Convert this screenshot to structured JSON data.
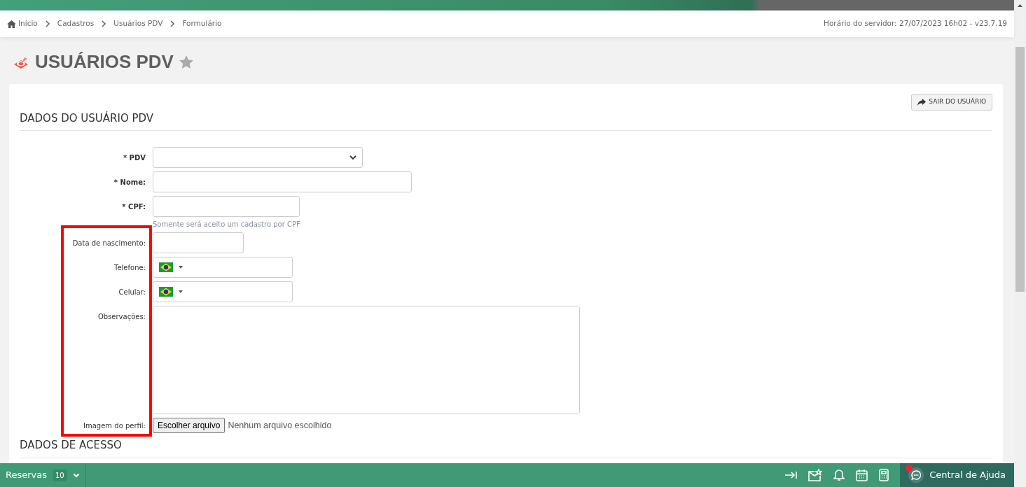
{
  "breadcrumb": [
    {
      "label": "Início"
    },
    {
      "label": "Cadastros"
    },
    {
      "label": "Usuários PDV"
    },
    {
      "label": "Formulário"
    }
  ],
  "server_info": "Horário do servidor: 27/07/2023 16h02 - v23.7.19",
  "page_title": "USUÁRIOS PDV",
  "favorite": false,
  "exit_button": "SAIR DO USUÁRIO",
  "section_title": "DADOS DO USUÁRIO PDV",
  "fields": [
    {
      "kind": "select",
      "label": "* PDV",
      "required": true
    },
    {
      "kind": "text",
      "label": "* Nome:",
      "required": true
    },
    {
      "kind": "text",
      "label": "* CPF:",
      "required": true,
      "hint": "Somente será aceito um cadastro por CPF"
    },
    {
      "kind": "date",
      "label": "Data de nascimento:",
      "required": false
    },
    {
      "kind": "phone",
      "label": "Telefone:",
      "required": false
    },
    {
      "kind": "phone",
      "label": "Celular:",
      "required": false
    },
    {
      "kind": "textarea",
      "label": "Observações:",
      "required": false
    },
    {
      "kind": "file",
      "label": "Imagem do perfil:",
      "required": false,
      "button": "Escolher arquivo",
      "status": "Nenhum arquivo escolhido"
    }
  ],
  "section2_title": "DADOS DE ACESSO",
  "bottom_bar": {
    "reservas": "Reservas",
    "count": "10",
    "help": "Central de Ajuda",
    "help_notification": true
  }
}
